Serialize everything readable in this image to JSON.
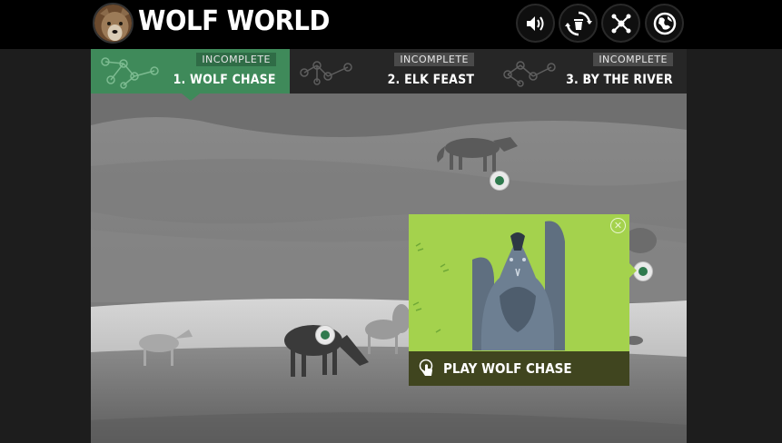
{
  "app": {
    "title": "WOLF WORLD"
  },
  "toolbar": {
    "buttons": [
      {
        "name": "sound-icon"
      },
      {
        "name": "recycle-trash-icon"
      },
      {
        "name": "network-icon"
      },
      {
        "name": "globe-icon"
      }
    ]
  },
  "tabs": [
    {
      "status": "INCOMPLETE",
      "label": "1. WOLF CHASE",
      "active": true
    },
    {
      "status": "INCOMPLETE",
      "label": "2. ELK FEAST",
      "active": false
    },
    {
      "status": "INCOMPLETE",
      "label": "3. BY THE RIVER",
      "active": false
    }
  ],
  "popup": {
    "play_label": "PLAY WOLF CHASE",
    "close_icon": "close-icon",
    "hand_icon": "hand-pointer-icon"
  },
  "colors": {
    "accent_green": "#3f8a5a",
    "popup_green": "#a4d24d",
    "popup_bar": "#40451f"
  }
}
